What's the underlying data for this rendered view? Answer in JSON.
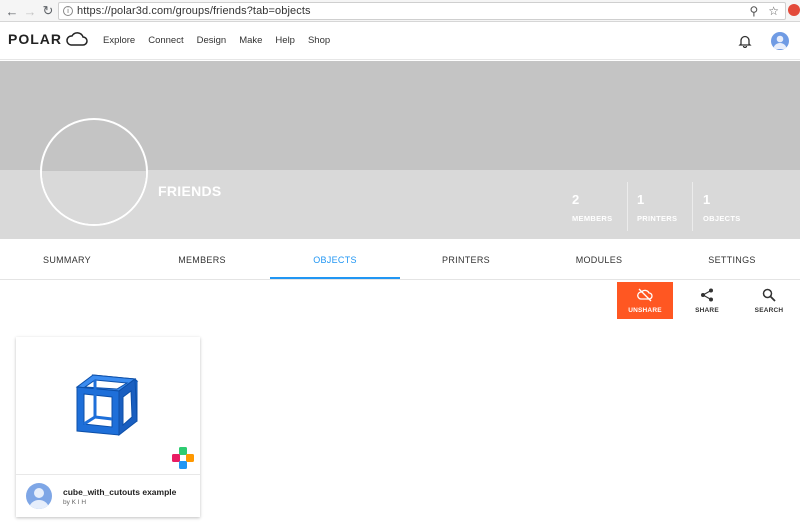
{
  "browser": {
    "url": "https://polar3d.com/groups/friends?tab=objects",
    "icons": [
      "back-icon",
      "forward-icon",
      "reload-icon",
      "info-icon",
      "zoom-icon",
      "star-icon",
      "extension-icon"
    ]
  },
  "header": {
    "logo_text": "POLAR",
    "nav": [
      "Explore",
      "Connect",
      "Design",
      "Make",
      "Help",
      "Shop"
    ],
    "icons": [
      "bell-icon",
      "user-avatar-icon"
    ]
  },
  "group": {
    "name": "FRIENDS",
    "stats": [
      {
        "value": "2",
        "label": "MEMBERS"
      },
      {
        "value": "1",
        "label": "PRINTERS"
      },
      {
        "value": "1",
        "label": "OBJECTS"
      }
    ]
  },
  "tabs": [
    "SUMMARY",
    "MEMBERS",
    "OBJECTS",
    "PRINTERS",
    "MODULES",
    "SETTINGS"
  ],
  "active_tab": "OBJECTS",
  "actions": [
    {
      "label": "UNSHARE",
      "icon": "cloud-off-icon"
    },
    {
      "label": "SHARE",
      "icon": "share-icon"
    },
    {
      "label": "SEARCH",
      "icon": "search-icon"
    }
  ],
  "objects": [
    {
      "title": "cube_with_cutouts example",
      "owner": "by K I H"
    }
  ],
  "colors": {
    "accent": "#2196f3",
    "unshare": "#ff5722",
    "banner": "#c4c4c4",
    "banner_lower": "#d9d9d9"
  }
}
